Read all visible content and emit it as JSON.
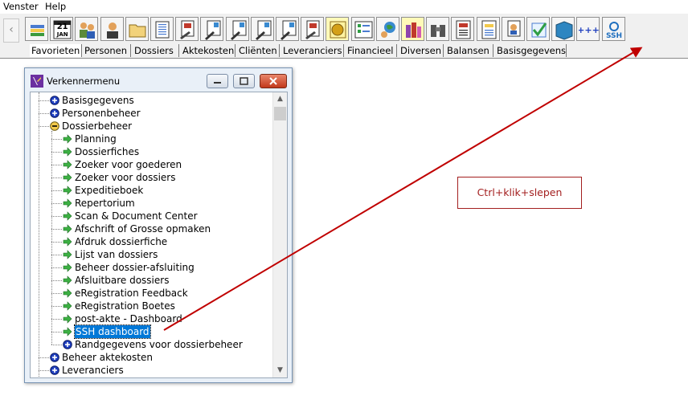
{
  "menubar": {
    "items": [
      "Venster",
      "Help"
    ]
  },
  "toolbar": {
    "buttons": [
      "stack-icon",
      "calendar-icon",
      "people-icon",
      "person-icon",
      "folder-icon",
      "document-icon",
      "deed-icon",
      "euro-deed-icon",
      "euro-deed-icon",
      "euro-deed-icon",
      "euro-deed-icon",
      "deed-icon",
      "euro-coin-icon",
      "checklist-icon",
      "globe-icon",
      "books-icon",
      "binoculars-icon",
      "register-icon",
      "form-icon",
      "certificate-icon",
      "check-icon",
      "book-icon",
      "plus-icon",
      "ssh-icon"
    ],
    "calendar_day": "21",
    "calendar_month": "JAN",
    "plus_label": "+++",
    "ssh_label": "SSH"
  },
  "tabs": [
    "Favorieten",
    "Personen",
    "Dossiers",
    "Aktekosten",
    "Cliënten",
    "Leveranciers",
    "Financieel",
    "Diversen",
    "Balansen",
    "Basisgegevens"
  ],
  "window": {
    "title": "Verkennermenu",
    "tree": [
      {
        "label": "Basisgegevens",
        "level": 0,
        "icon": "plus-circle-icon"
      },
      {
        "label": "Personenbeheer",
        "level": 0,
        "icon": "plus-circle-icon"
      },
      {
        "label": "Dossierbeheer",
        "level": 0,
        "icon": "minus-circle-icon"
      },
      {
        "label": "Planning",
        "level": 1,
        "icon": "green-arrow-icon"
      },
      {
        "label": "Dossierfiches",
        "level": 1,
        "icon": "green-arrow-icon"
      },
      {
        "label": "Zoeker voor goederen",
        "level": 1,
        "icon": "green-arrow-icon"
      },
      {
        "label": "Zoeker voor dossiers",
        "level": 1,
        "icon": "green-arrow-icon"
      },
      {
        "label": "Expeditieboek",
        "level": 1,
        "icon": "green-arrow-icon"
      },
      {
        "label": "Repertorium",
        "level": 1,
        "icon": "green-arrow-icon"
      },
      {
        "label": "Scan & Document Center",
        "level": 1,
        "icon": "green-arrow-icon"
      },
      {
        "label": "Afschrift of Grosse opmaken",
        "level": 1,
        "icon": "green-arrow-icon"
      },
      {
        "label": "Afdruk dossierfiche",
        "level": 1,
        "icon": "green-arrow-icon"
      },
      {
        "label": "Lijst van dossiers",
        "level": 1,
        "icon": "green-arrow-icon"
      },
      {
        "label": "Beheer dossier-afsluiting",
        "level": 1,
        "icon": "green-arrow-icon"
      },
      {
        "label": "Afsluitbare dossiers",
        "level": 1,
        "icon": "green-arrow-icon"
      },
      {
        "label": "eRegistration Feedback",
        "level": 1,
        "icon": "green-arrow-icon"
      },
      {
        "label": "eRegistration Boetes",
        "level": 1,
        "icon": "green-arrow-icon"
      },
      {
        "label": "post-akte - Dashboard",
        "level": 1,
        "icon": "green-arrow-icon"
      },
      {
        "label": "SSH dashboard",
        "level": 1,
        "icon": "green-arrow-icon",
        "selected": true
      },
      {
        "label": "Randgegevens voor dossierbeheer",
        "level": 1,
        "icon": "plus-circle-icon"
      },
      {
        "label": "Beheer aktekosten",
        "level": 0,
        "icon": "plus-circle-icon"
      },
      {
        "label": "Leveranciers",
        "level": 0,
        "icon": "plus-circle-icon"
      }
    ]
  },
  "annotation": {
    "text": "Ctrl+klik+slepen",
    "color": "#a31f1f"
  },
  "colors": {
    "selection": "#0078d7",
    "arrow_green": "#3cb043",
    "accent_red": "#c00000"
  }
}
